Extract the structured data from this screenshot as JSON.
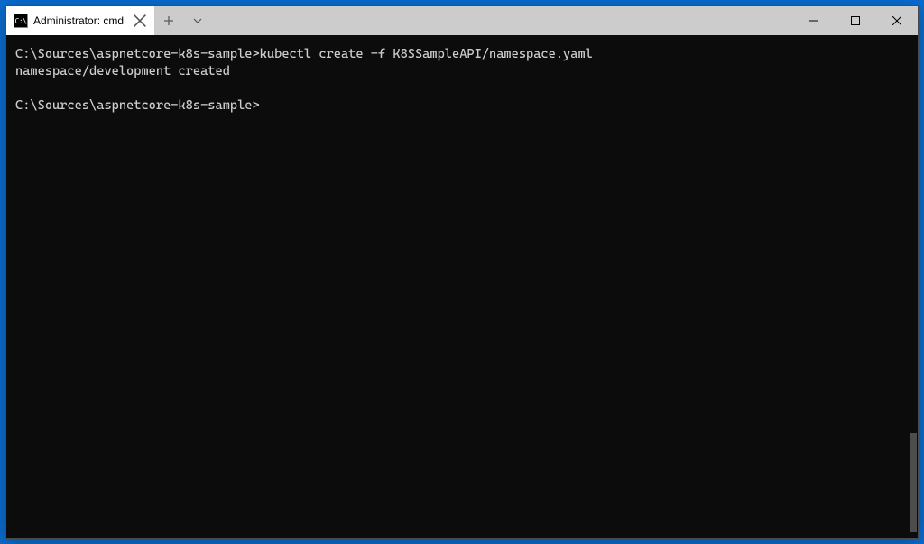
{
  "window": {
    "tab": {
      "icon_text": "C:\\",
      "title": "Administrator: cmd"
    }
  },
  "terminal": {
    "line1_prompt": "C:\\Sources\\aspnetcore-k8s-sample>",
    "line1_cmd": "kubectl create -f K8SSampleAPI/namespace.yaml",
    "line2": "namespace/development created",
    "line3_prompt": "C:\\Sources\\aspnetcore-k8s-sample>"
  }
}
